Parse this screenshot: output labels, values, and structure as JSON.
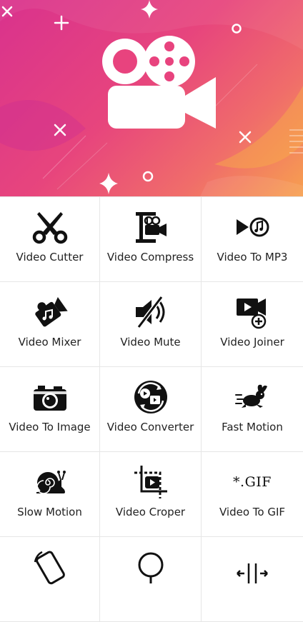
{
  "banner": {
    "logo_icon": "movie-camera-icon",
    "colors": [
      "#d9328d",
      "#f06d6a",
      "#f7a04f"
    ]
  },
  "tools": [
    {
      "label": "Video Cutter",
      "icon": "scissors-icon"
    },
    {
      "label": "Video Compress",
      "icon": "clamp-camera-icon"
    },
    {
      "label": "Video To MP3",
      "icon": "play-music-icon"
    },
    {
      "label": "Video Mixer",
      "icon": "camera-music-icon"
    },
    {
      "label": "Video Mute",
      "icon": "speaker-mute-icon"
    },
    {
      "label": "Video Joiner",
      "icon": "video-add-icon"
    },
    {
      "label": "Video To Image",
      "icon": "photo-camera-icon"
    },
    {
      "label": "Video Converter",
      "icon": "convert-icon"
    },
    {
      "label": "Fast Motion",
      "icon": "rabbit-icon"
    },
    {
      "label": "Slow Motion",
      "icon": "snail-icon"
    },
    {
      "label": "Video Croper",
      "icon": "crop-icon"
    },
    {
      "label": "Video To GIF",
      "icon": "gif-icon",
      "gif_text": "*.GIF"
    },
    {
      "label": "",
      "icon": "rotate-icon"
    },
    {
      "label": "",
      "icon": "mirror-icon"
    },
    {
      "label": "",
      "icon": "split-icon"
    }
  ]
}
